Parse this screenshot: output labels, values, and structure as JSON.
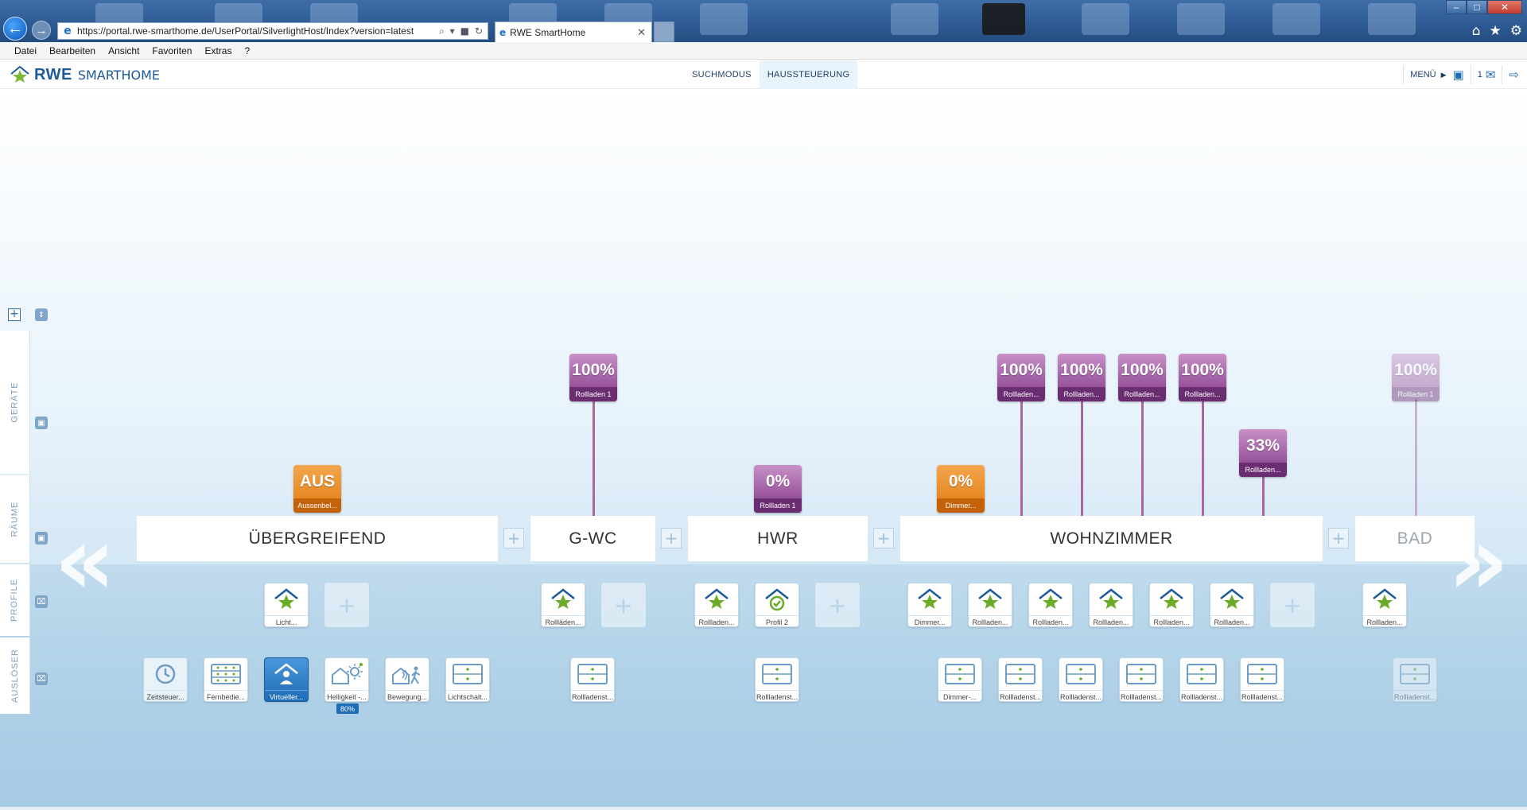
{
  "browser": {
    "url": "https://portal.rwe-smarthome.de/UserPortal/SilverlightHost/Index?version=latest",
    "tab_title": "RWE SmartHome",
    "menu": [
      "Datei",
      "Bearbeiten",
      "Ansicht",
      "Favoriten",
      "Extras",
      "?"
    ]
  },
  "app": {
    "logo_rwe": "RWE",
    "logo_smarthome": "SMARTHOME",
    "nav": [
      "SUCHMODUS",
      "HAUSSTEUERUNG"
    ],
    "menu_label": "MENÜ",
    "message_count": "1"
  },
  "side_panel": {
    "geraete": "GERÄTE",
    "raeume": "RÄUME",
    "profile": "PROFILE",
    "ausloeser": "AUSLÖSER"
  },
  "rooms": [
    {
      "name": "ÜBERGREIFEND"
    },
    {
      "name": "G-WC"
    },
    {
      "name": "HWR"
    },
    {
      "name": "WOHNZIMMER"
    },
    {
      "name": "BAD"
    }
  ],
  "devices": [
    {
      "value": "AUS",
      "label": "Aussenbel...",
      "color": "#e07b12"
    },
    {
      "value": "100%",
      "label": "Rollladen 1",
      "color": "#9d5aa0"
    },
    {
      "value": "0%",
      "label": "Rollladen 1",
      "color": "#9d5aa0"
    },
    {
      "value": "0%",
      "label": "Dimmer...",
      "color": "#e07b12"
    },
    {
      "value": "100%",
      "label": "Rollladen..."
    },
    {
      "value": "100%",
      "label": "Rollladen..."
    },
    {
      "value": "100%",
      "label": "Rollladen..."
    },
    {
      "value": "100%",
      "label": "Rollladen..."
    },
    {
      "value": "33%",
      "label": "Rollladen..."
    },
    {
      "value": "100%",
      "label": "Rollladen 1"
    }
  ],
  "profiles": [
    {
      "label": "Licht...",
      "icon": "house-star-icon"
    },
    {
      "label": "Rollläden...",
      "icon": "house-star-icon"
    },
    {
      "label": "Rollladen...",
      "icon": "house-star-icon"
    },
    {
      "label": "Profil 2",
      "icon": "clock-check-icon"
    },
    {
      "label": "Dimmer...",
      "icon": "house-star-icon"
    },
    {
      "label": "Rollladen...",
      "icon": "house-star-icon"
    },
    {
      "label": "Rollladen...",
      "icon": "house-star-icon"
    },
    {
      "label": "Rollladen...",
      "icon": "house-star-icon"
    },
    {
      "label": "Rollladen...",
      "icon": "house-star-icon"
    },
    {
      "label": "Rollladen...",
      "icon": "house-star-icon"
    },
    {
      "label": "Rollladen...",
      "icon": "house-star-icon"
    }
  ],
  "triggers": [
    {
      "label": "Zeitsteuer...",
      "icon": "clock-icon"
    },
    {
      "label": "Fernbedie...",
      "icon": "remote-icon"
    },
    {
      "label": "Virtueller...",
      "icon": "person-house-icon"
    },
    {
      "label": "Helligkeit -...",
      "icon": "sun-house-icon",
      "badge": "80%"
    },
    {
      "label": "Bewegung...",
      "icon": "motion-icon"
    },
    {
      "label": "Lichtschalt...",
      "icon": "switch-icon"
    },
    {
      "label": "Rollladenst...",
      "icon": "switch-icon"
    },
    {
      "label": "Rollladenst...",
      "icon": "switch-icon"
    },
    {
      "label": "Dimmer-...",
      "icon": "switch-icon"
    },
    {
      "label": "Rollladenst...",
      "icon": "switch-icon"
    },
    {
      "label": "Rollladenst...",
      "icon": "switch-icon"
    },
    {
      "label": "Rollladenst...",
      "icon": "switch-icon"
    },
    {
      "label": "Rollladenst...",
      "icon": "switch-icon"
    },
    {
      "label": "Rollladenst...",
      "icon": "switch-icon"
    },
    {
      "label": "Rollladenst...",
      "icon": "switch-icon"
    }
  ]
}
